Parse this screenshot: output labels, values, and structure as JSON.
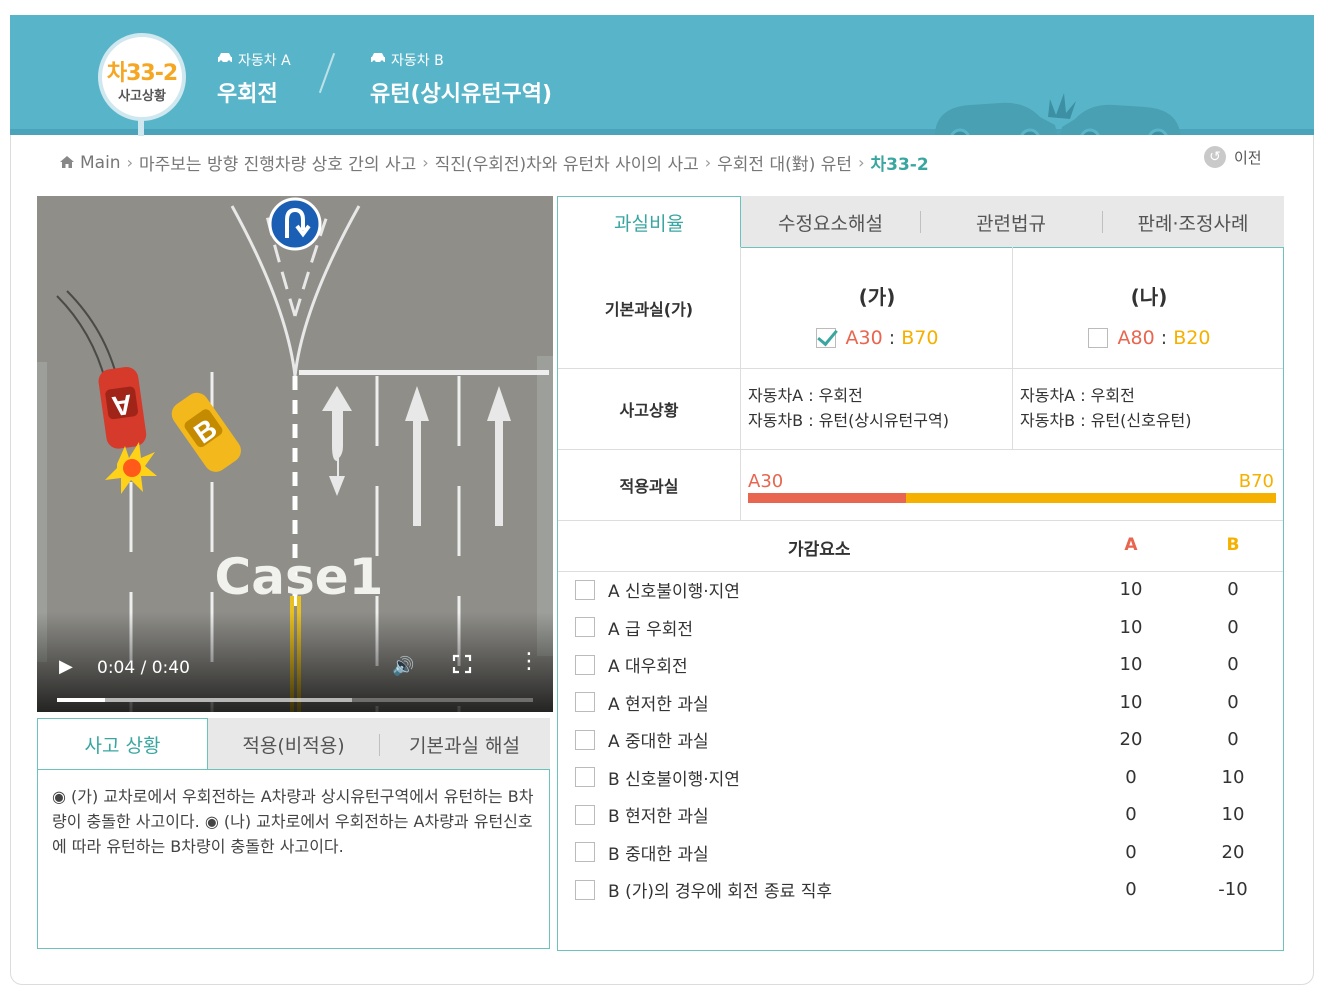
{
  "header": {
    "badge_code": "차33-2",
    "badge_sub": "사고상황",
    "vehicle_a_label": "자동차 A",
    "vehicle_a_value": "우회전",
    "vehicle_b_label": "자동차 B",
    "vehicle_b_value": "유턴(상시유턴구역)",
    "colors": {
      "bg": "#58b5c9",
      "badge_text": "#f5a623"
    }
  },
  "breadcrumb": {
    "items": [
      "Main",
      "마주보는 방향 진행차량 상호 간의 사고",
      "직진(우회전)차와 유턴차 사이의 사고",
      "우회전 대(對) 유턴"
    ],
    "current": "차33-2"
  },
  "back_label": "이전",
  "video": {
    "overlay_text": "Case1",
    "car_a_label": "A",
    "car_b_label": "B",
    "time": "0:04 / 0:40",
    "progress_fraction": 0.1,
    "buffered_fraction": 0.62,
    "icons": [
      "play-icon",
      "volume-icon",
      "fullscreen-icon",
      "more-icon",
      "u-turn-sign-icon"
    ]
  },
  "left_tabs": [
    "사고 상황",
    "적용(비적용)",
    "기본과실 해설"
  ],
  "left_body": "◉ (가) 교차로에서 우회전하는 A차량과 상시유턴구역에서 유턴하는 B차량이 충돌한 사고이다. ◉ (나) 교차로에서 우회전하는 A차량과 유턴신호에 따라 유턴하는 B차량이 충돌한 사고이다.",
  "right_tabs": [
    "과실비율",
    "수정요소해설",
    "관련법규",
    "판례·조정사례"
  ],
  "fault": {
    "basic_label": "기본과실(가)",
    "options": [
      {
        "title": "(가)",
        "checked": true,
        "a": "A30",
        "b": "B70"
      },
      {
        "title": "(나)",
        "checked": false,
        "a": "A80",
        "b": "B20"
      }
    ],
    "situation_label": "사고상황",
    "situations": [
      {
        "a": "자동차A : 우회전",
        "b": "자동차B : 유턴(상시유턴구역)"
      },
      {
        "a": "자동차A : 우회전",
        "b": "자동차B : 유턴(신호유턴)"
      }
    ],
    "applied_label": "적용과실",
    "applied_a": "A30",
    "applied_b": "B70",
    "applied_a_fraction": 0.3,
    "colors": {
      "a": "#e8664f",
      "b": "#f5b000",
      "accent": "#3aa6a0"
    }
  },
  "factors": {
    "header": "가감요소",
    "col_a": "A",
    "col_b": "B",
    "rows": [
      {
        "name": "A 신호불이행·지연",
        "a": "10",
        "b": "0"
      },
      {
        "name": "A 급 우회전",
        "a": "10",
        "b": "0"
      },
      {
        "name": "A 대우회전",
        "a": "10",
        "b": "0"
      },
      {
        "name": "A 현저한 과실",
        "a": "10",
        "b": "0"
      },
      {
        "name": "A 중대한 과실",
        "a": "20",
        "b": "0"
      },
      {
        "name": "B 신호불이행·지연",
        "a": "0",
        "b": "10"
      },
      {
        "name": "B 현저한 과실",
        "a": "0",
        "b": "10"
      },
      {
        "name": "B 중대한 과실",
        "a": "0",
        "b": "20"
      },
      {
        "name": "B (가)의 경우에 회전 종료 직후",
        "a": "0",
        "b": "-10"
      }
    ]
  }
}
